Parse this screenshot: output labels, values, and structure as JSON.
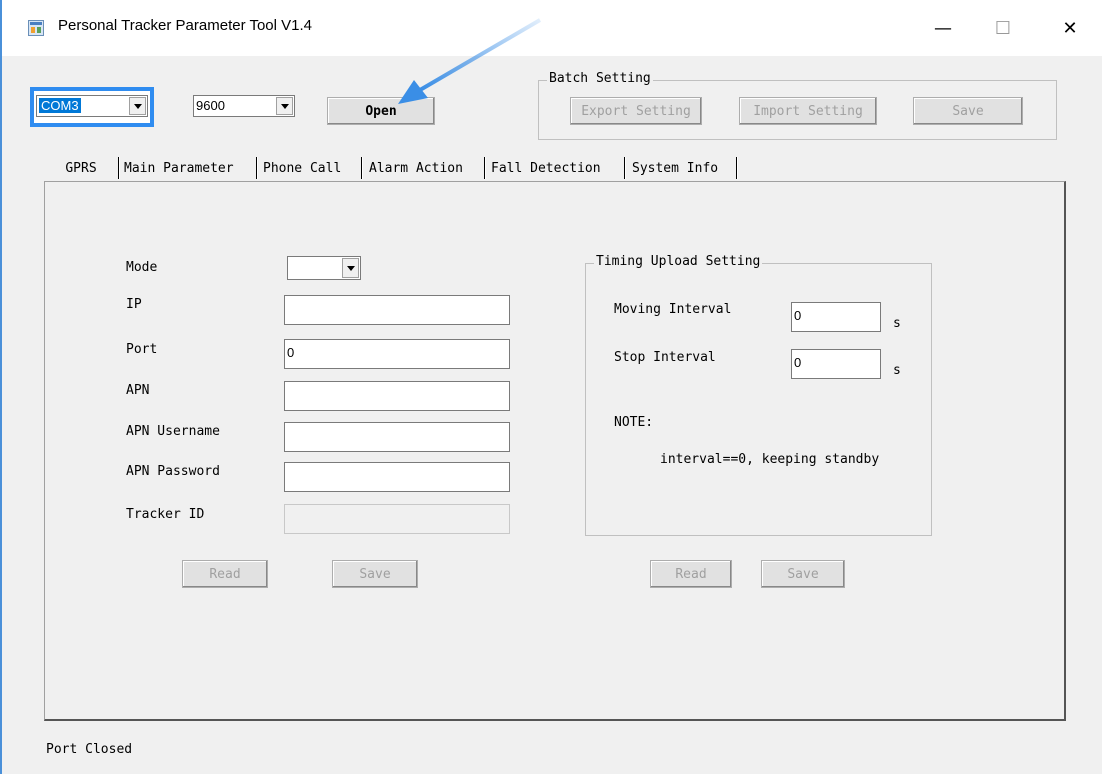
{
  "window": {
    "title": "Personal Tracker Parameter Tool V1.4"
  },
  "toolbar": {
    "com_port": "COM3",
    "baud_rate": "9600",
    "open_label": "Open"
  },
  "batch": {
    "legend": "Batch Setting",
    "export_label": "Export Setting",
    "import_label": "Import Setting",
    "save_label": "Save"
  },
  "tabs": [
    {
      "label": "GPRS",
      "active": true
    },
    {
      "label": "Main Parameter"
    },
    {
      "label": "Phone Call"
    },
    {
      "label": "Alarm Action"
    },
    {
      "label": "Fall Detection"
    },
    {
      "label": "System Info"
    }
  ],
  "gprs": {
    "mode_label": "Mode",
    "mode_value": "",
    "ip_label": "IP",
    "ip_value": "",
    "port_label": "Port",
    "port_value": "0",
    "apn_label": "APN",
    "apn_value": "",
    "apn_user_label": "APN Username",
    "apn_user_value": "",
    "apn_pass_label": "APN Password",
    "apn_pass_value": "",
    "tracker_id_label": "Tracker ID",
    "tracker_id_value": "",
    "read_label": "Read",
    "save_label": "Save"
  },
  "timing": {
    "legend": "Timing Upload Setting",
    "moving_label": "Moving Interval",
    "moving_value": "0",
    "moving_unit": "s",
    "stop_label": "Stop Interval",
    "stop_value": "0",
    "stop_unit": "s",
    "note_label": "NOTE:",
    "note_text": "interval==0, keeping standby",
    "read_label": "Read",
    "save_label": "Save"
  },
  "status": {
    "text": "Port Closed"
  },
  "colors": {
    "highlight": "#2f8cf0",
    "arrow": "#3a8ee6",
    "selection": "#0078d7"
  }
}
